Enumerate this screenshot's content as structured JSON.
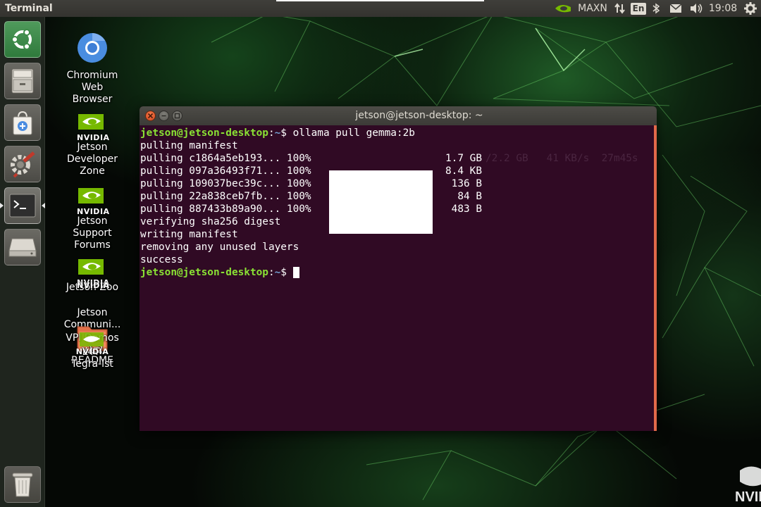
{
  "top_panel": {
    "app_title": "Terminal",
    "power_mode": "MAXN",
    "keyboard_layout": "En",
    "clock": "19:08",
    "icons": [
      "nvidia-icon",
      "network-arrows-icon",
      "bluetooth-icon",
      "mail-icon",
      "volume-icon",
      "gear-icon"
    ]
  },
  "launcher": {
    "items": [
      {
        "name": "ubuntu-dash",
        "icon": "ubuntu-logo-icon"
      },
      {
        "name": "files",
        "icon": "file-cabinet-icon"
      },
      {
        "name": "software-store",
        "icon": "shopping-bag-icon"
      },
      {
        "name": "system-settings",
        "icon": "settings-tools-icon"
      },
      {
        "name": "terminal",
        "icon": "terminal-icon",
        "running": true
      },
      {
        "name": "disk",
        "icon": "drive-icon"
      },
      {
        "name": "trash",
        "icon": "trash-icon"
      }
    ]
  },
  "desktop_icons": [
    {
      "label": "Chromium\nWeb\nBrowser",
      "icon": "chromium-icon"
    },
    {
      "label": "Jetson\nDeveloper\nZone",
      "icon": "nvidia-icon",
      "logo_text": "NVIDIA"
    },
    {
      "label": "Jetson\nSupport\nForums",
      "icon": "nvidia-icon",
      "logo_text": "NVIDIA"
    },
    {
      "label": "Jetson Zoo",
      "icon": "nvidia-icon",
      "logo_text": "NVIDIA"
    },
    {
      "label": "Jetson\nCommuni...",
      "icon": "nvidia-icon",
      "logo_text": "NVIDIA"
    },
    {
      "label": "VPI Demos\nv1.2",
      "icon": "folder-icon"
    },
    {
      "label": "L4T-\nREADME",
      "icon": "folder-icon"
    },
    {
      "label": "Tegra-lst",
      "icon": "nvidia-icon",
      "logo_text": "NVIDIA"
    }
  ],
  "terminal": {
    "window_title": "jetson@jetson-desktop: ~",
    "prompt": {
      "user_host": "jetson@jetson-desktop",
      "sep": ":",
      "path": "~",
      "symbol": "$ "
    },
    "command": "ollama pull gemma:2b",
    "lines_before": [
      "pulling manifest"
    ],
    "pulls": [
      {
        "name": "pulling c1864a5eb193... 100%",
        "size": "1.7 GB"
      },
      {
        "name": "pulling 097a36493f71... 100%",
        "size": "8.4 KB"
      },
      {
        "name": "pulling 109037bec39c... 100%",
        "size": "136 B"
      },
      {
        "name": "pulling 22a838ceb7fb... 100%",
        "size": "84 B"
      },
      {
        "name": "pulling 887433b89a90... 100%",
        "size": "483 B"
      }
    ],
    "ghost_text": "/2.2 GB   41 KB/s  27m45s",
    "lines_after": [
      "verifying sha256 digest",
      "writing manifest",
      "removing any unused layers",
      "success"
    ]
  },
  "colors": {
    "terminal_bg": "#300a24",
    "prompt_green": "#8ae234",
    "prompt_blue": "#729fcf",
    "close_orange": "#e0562a"
  }
}
